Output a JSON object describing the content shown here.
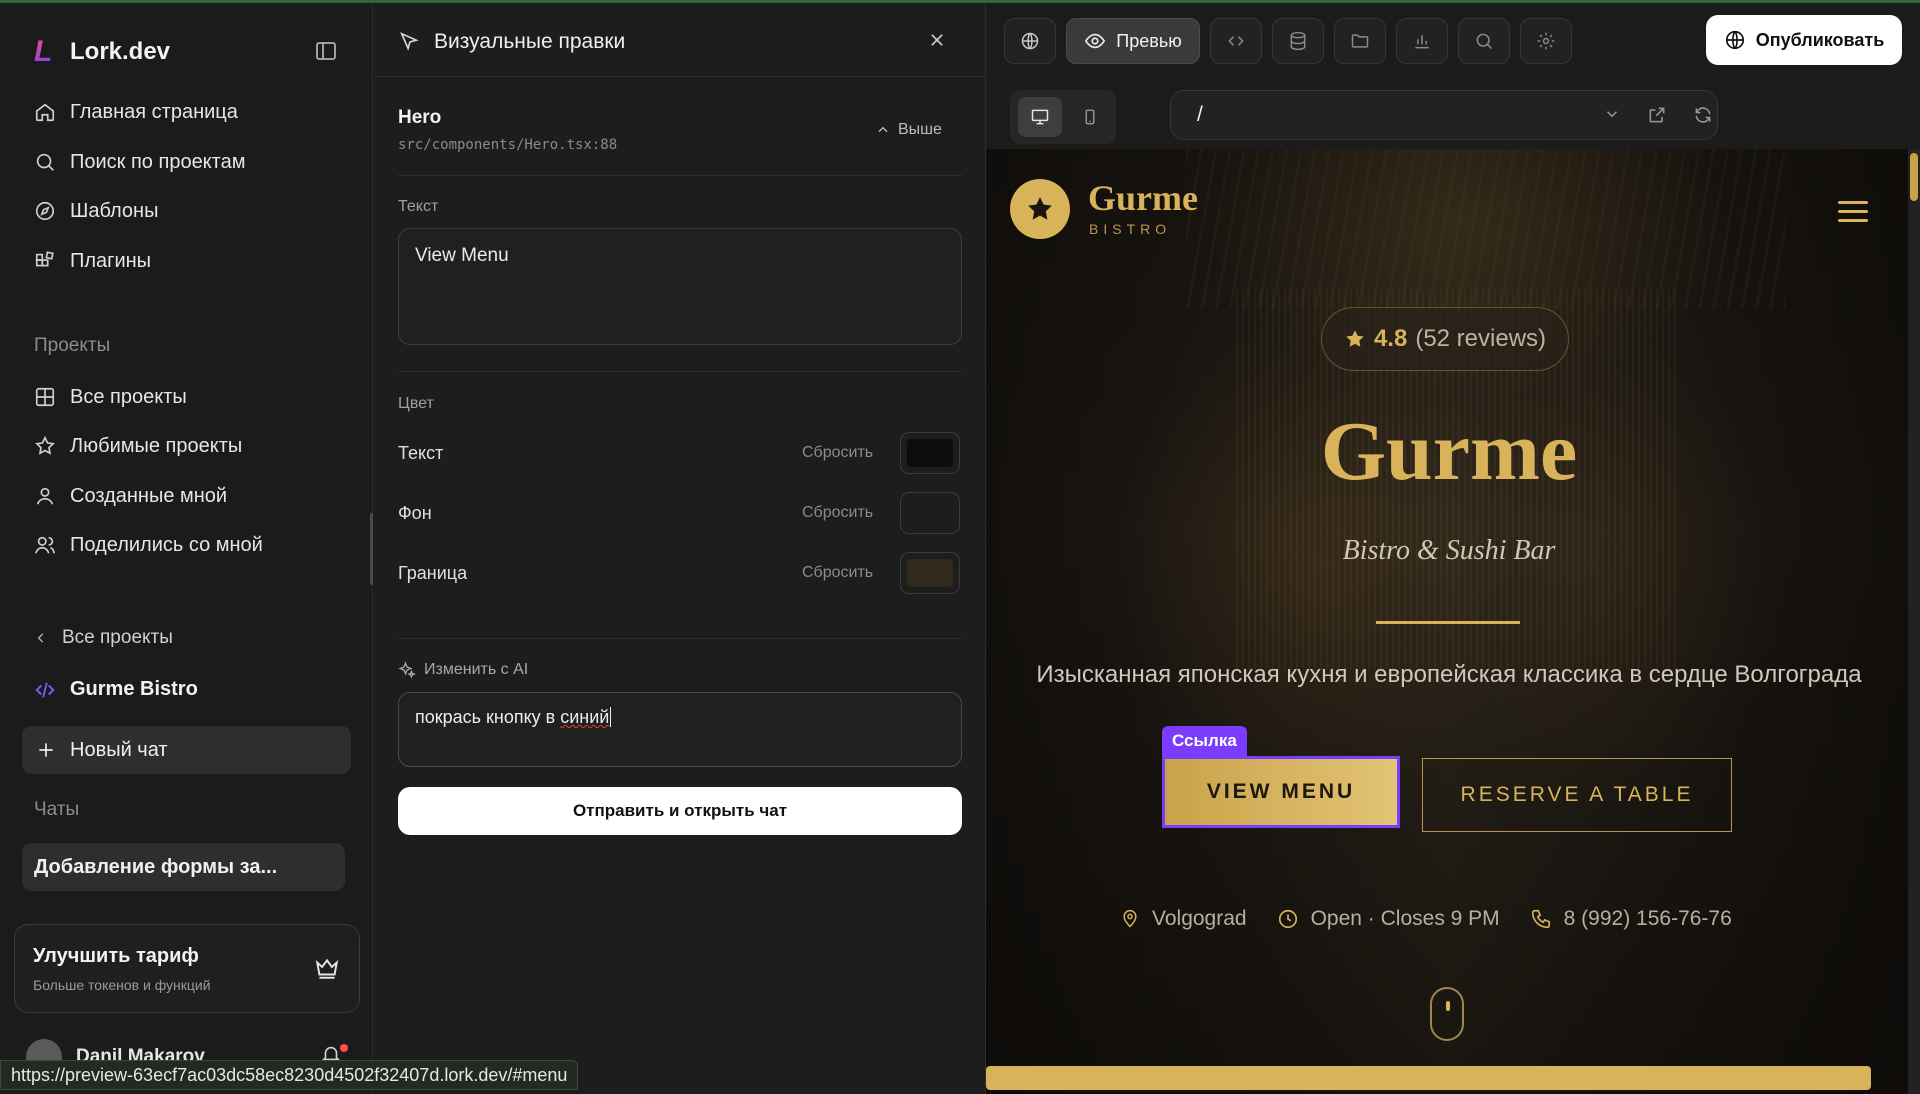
{
  "sidebar": {
    "logo_mark": "L",
    "logo_text": "Lork.dev",
    "nav": [
      {
        "label": "Главная страница",
        "icon": "home-icon"
      },
      {
        "label": "Поиск по проектам",
        "icon": "search-icon"
      },
      {
        "label": "Шаблоны",
        "icon": "compass-icon"
      },
      {
        "label": "Плагины",
        "icon": "plugins-icon"
      }
    ],
    "projects_label": "Проекты",
    "projects": [
      {
        "label": "Все проекты",
        "icon": "grid-icon"
      },
      {
        "label": "Любимые проекты",
        "icon": "star-icon"
      },
      {
        "label": "Созданные мной",
        "icon": "user-icon"
      },
      {
        "label": "Поделились со мной",
        "icon": "users-icon"
      }
    ],
    "back_label": "Все проекты",
    "current_project": "Gurme Bistro",
    "new_chat": "Новый чат",
    "chats_label": "Чаты",
    "chats": [
      "Добавление формы за..."
    ],
    "upgrade": {
      "title": "Улучшить тариф",
      "subtitle": "Больше токенов и функций"
    },
    "user_name": "Danil Makarov"
  },
  "panel": {
    "title": "Визуальные правки",
    "component_name": "Hero",
    "component_path": "src/components/Hero.tsx:88",
    "up_label": "Выше",
    "text_label": "Текст",
    "text_value": "View Menu",
    "color_label": "Цвет",
    "color_rows": [
      {
        "label": "Текст",
        "reset": "Сбросить",
        "color": "#0d0d0d"
      },
      {
        "label": "Фон",
        "reset": "Сбросить",
        "color": "#1b1b1b"
      },
      {
        "label": "Граница",
        "reset": "Сбросить",
        "color": "#2f2a1a"
      }
    ],
    "ai_label": "Изменить с AI",
    "ai_input_plain": "покрась кнопку в ",
    "ai_input_spell": "синий",
    "send_label": "Отправить и открыть чат"
  },
  "toolbar": {
    "preview_label": "Превью",
    "publish_label": "Опубликовать",
    "url_path": "/"
  },
  "site": {
    "brand_name": "Gurme",
    "brand_sub": "BISTRO",
    "rating_value": "4.8",
    "rating_reviews": "(52 reviews)",
    "hero_title": "Gurme",
    "hero_subtitle": "Bistro & Sushi Bar",
    "hero_description": "Изысканная японская кухня и европейская классика в сердце Волгограда",
    "link_tag": "Ссылка",
    "btn_menu": "VIEW MENU",
    "btn_reserve": "RESERVE A TABLE",
    "info_location": "Volgograd",
    "info_hours": "Open · Closes 9 PM",
    "info_phone": "8 (992) 156-76-76",
    "accent_color": "#d8b35a"
  },
  "status_url": "https://preview-63ecf7ac03dc58ec8230d4502f32407d.lork.dev/#menu"
}
